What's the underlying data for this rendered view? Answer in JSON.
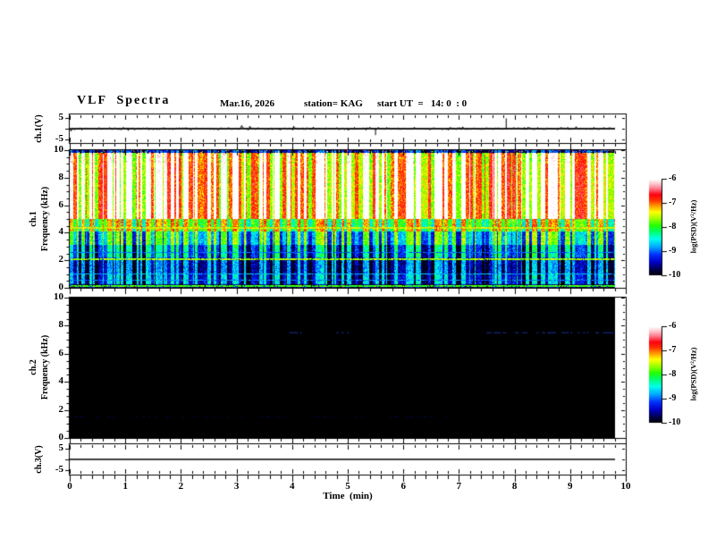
{
  "header": {
    "title": "VLF  Spectra",
    "date": "Mar.16, 2026",
    "station": "station= KAG",
    "start_ut": "start UT  =   14: 0  : 0"
  },
  "panels": {
    "ch1": {
      "label": "ch.1(V)",
      "ticks": [
        "5",
        "-5"
      ]
    },
    "spec1": {
      "label_ch": "ch.1",
      "label_axis": "Frequency (kHz)"
    },
    "spec2": {
      "label_ch": "ch.2",
      "label_axis": "Frequency (kHz)"
    },
    "ch3": {
      "label": "ch.3(V)",
      "ticks": [
        "5",
        "-5"
      ]
    }
  },
  "time_axis": {
    "label": "Time  (min)",
    "tick_labels": [
      "0",
      "1",
      "2",
      "3",
      "4",
      "5",
      "6",
      "7",
      "8",
      "9",
      "10"
    ]
  },
  "freq_axis": {
    "tick_labels": [
      "10",
      "8",
      "6",
      "4",
      "2",
      "0"
    ]
  },
  "colorbar": {
    "label": "log(PSD)(V²/Hz)",
    "tick_labels": [
      "-6",
      "-7",
      "-8",
      "-9",
      "-10"
    ],
    "vmin": -10,
    "vmax": -6,
    "stops": [
      [
        0.0,
        "#000000"
      ],
      [
        0.06,
        "#000045"
      ],
      [
        0.14,
        "#0000c8"
      ],
      [
        0.22,
        "#0030ff"
      ],
      [
        0.3,
        "#00aaff"
      ],
      [
        0.38,
        "#00ffee"
      ],
      [
        0.46,
        "#00ff66"
      ],
      [
        0.52,
        "#22ff00"
      ],
      [
        0.6,
        "#aaff00"
      ],
      [
        0.66,
        "#ffff00"
      ],
      [
        0.72,
        "#ffa000"
      ],
      [
        0.78,
        "#ff3300"
      ],
      [
        0.84,
        "#ff0011"
      ],
      [
        0.9,
        "#ff7788"
      ],
      [
        0.95,
        "#ffc4cc"
      ],
      [
        1.0,
        "#ffffff"
      ]
    ]
  },
  "chart_data": [
    {
      "type": "line",
      "panel": "ch.1 voltage waveform",
      "xlim_min": [
        0,
        10
      ],
      "ylim_v": [
        -5,
        5
      ],
      "baseline_v": 0,
      "noise_amp_v": 0.4,
      "spikes": [
        {
          "t_min": 5.5,
          "v_volts": -3.0
        },
        {
          "t_min": 7.85,
          "v_volts": 4.8
        }
      ],
      "data_end_min": 9.8
    },
    {
      "type": "heatmap",
      "panel": "ch.1 VLF spectrogram",
      "xlim_min": [
        0,
        10
      ],
      "ylim_khz": [
        0,
        10
      ],
      "zlim_log_psd": [
        -10,
        -6
      ],
      "bands": [
        {
          "f0": 9.82,
          "f1": 10.0,
          "base": -9.6,
          "amp": 0.5
        },
        {
          "f0": 9.0,
          "f1": 9.82,
          "base": -6.95,
          "amp": 1.0
        },
        {
          "f0": 5.0,
          "f1": 9.0,
          "base": -6.85,
          "amp": 1.05
        },
        {
          "f0": 4.1,
          "f1": 5.0,
          "base": -7.9,
          "amp": 0.7
        },
        {
          "f0": 3.1,
          "f1": 4.1,
          "base": -8.65,
          "amp": 0.85
        },
        {
          "f0": 2.2,
          "f1": 3.1,
          "base": -9.15,
          "amp": 0.8
        },
        {
          "f0": 1.05,
          "f1": 2.2,
          "base": -9.5,
          "amp": 0.65
        },
        {
          "f0": 0.25,
          "f1": 1.05,
          "base": -9.35,
          "amp": 0.7
        },
        {
          "f0": 0.0,
          "f1": 0.25,
          "base": -9.85,
          "amp": 0.3
        }
      ],
      "hlines": [
        {
          "f_khz": 4.35,
          "value": -7.4,
          "w": 2
        },
        {
          "f_khz": 2.08,
          "value": -7.6,
          "w": 2
        },
        {
          "f_khz": 0.12,
          "value": -7.9,
          "w": 2
        },
        {
          "f_khz": 1.0,
          "value": -8.7,
          "w": 1
        },
        {
          "f_khz": 0.55,
          "value": -8.9,
          "w": 1
        },
        {
          "f_khz": 2.55,
          "value": -8.95,
          "w": 1
        }
      ],
      "data_end_min": 9.8
    },
    {
      "type": "heatmap",
      "panel": "ch.2 VLF spectrogram",
      "xlim_min": [
        0,
        10
      ],
      "ylim_khz": [
        0,
        10
      ],
      "zlim_log_psd": [
        -10,
        -6
      ],
      "background_value": -10,
      "dotted_lines": [
        {
          "f_khz": 7.5,
          "segments_min": [
            [
              7.5,
              9.78
            ],
            [
              3.95,
              4.2
            ],
            [
              4.8,
              5.0
            ]
          ],
          "color": "#2244dd",
          "density": 0.55
        },
        {
          "f_khz": 1.5,
          "segments_min": [
            [
              0.1,
              6.8
            ]
          ],
          "color": "#000d66",
          "density": 0.3
        }
      ],
      "data_end_min": 9.8
    },
    {
      "type": "line",
      "panel": "ch.3 voltage waveform",
      "xlim_min": [
        0,
        10
      ],
      "ylim_v": [
        -5,
        5
      ],
      "constant_v": 0,
      "data_end_min": 9.8
    }
  ]
}
